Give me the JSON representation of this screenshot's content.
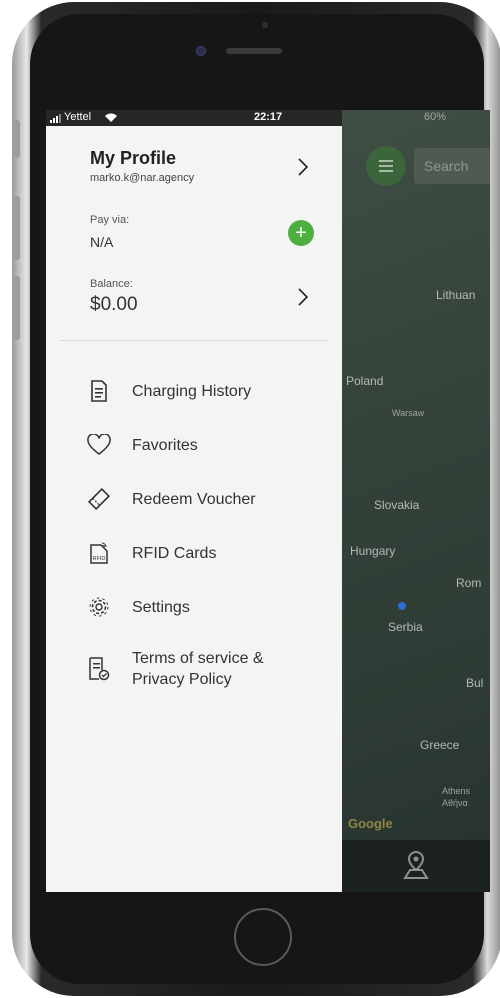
{
  "status": {
    "carrier": "Yettel",
    "time": "22:17",
    "battery": "60%"
  },
  "profile": {
    "title": "My Profile",
    "email": "marko.k@nar.agency"
  },
  "payment": {
    "label": "Pay via:",
    "value": "N/A"
  },
  "balance": {
    "label": "Balance:",
    "value": "$0.00"
  },
  "menu": {
    "items": [
      {
        "label": "Charging History",
        "icon": "document-icon"
      },
      {
        "label": "Favorites",
        "icon": "heart-icon"
      },
      {
        "label": "Redeem Voucher",
        "icon": "voucher-icon"
      },
      {
        "label": "RFID Cards",
        "icon": "rfid-card-icon"
      },
      {
        "label": "Settings",
        "icon": "gear-icon"
      },
      {
        "label": "Terms of service &",
        "label2": "Privacy Policy",
        "icon": "terms-icon"
      }
    ]
  },
  "map": {
    "search_placeholder": "Search",
    "labels": {
      "lithuania": "Lithuan",
      "poland": "Poland",
      "warsaw": "Warsaw",
      "slovakia": "Slovakia",
      "hungary": "Hungary",
      "romania": "Rom",
      "serbia": "Serbia",
      "bulgaria": "Bul",
      "greece": "Greece",
      "athens": "Athens",
      "athens_greek": "Αθήνα",
      "google": "Google"
    }
  },
  "colors": {
    "accent": "#4caf3f",
    "drawer_bg": "#f4f4f4",
    "map_bg": "#34423a"
  }
}
